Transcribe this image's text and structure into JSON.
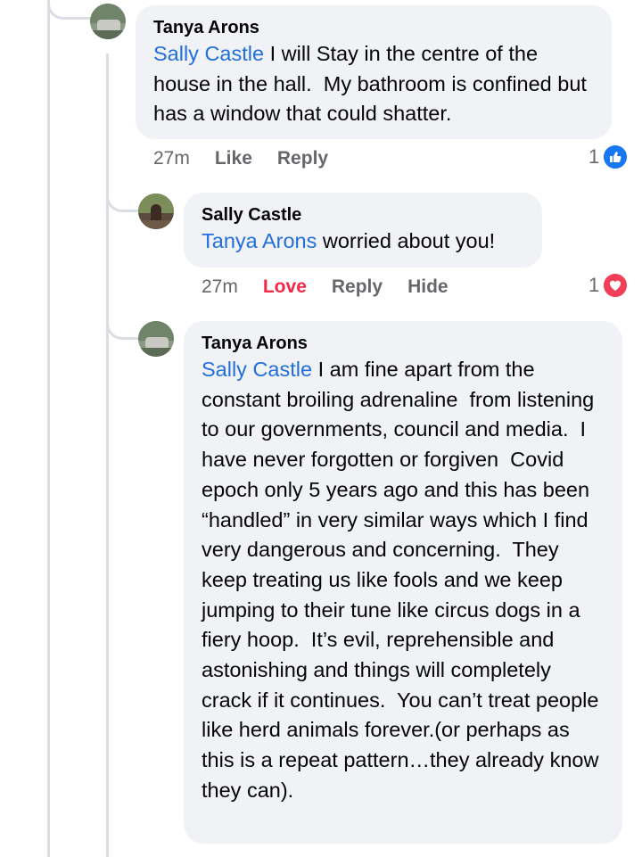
{
  "comments": [
    {
      "author": "Tanya Arons",
      "mention": "Sally Castle",
      "text": " I will Stay in the centre of the house in the hall.  My bathroom is confined but has a window that could shatter.",
      "time": "27m",
      "actions": [
        "Like",
        "Reply"
      ],
      "reaction_count": "1",
      "reaction_icon": "like-icon"
    },
    {
      "author": "Sally Castle",
      "mention": "Tanya Arons",
      "text": " worried about you!",
      "time": "27m",
      "actions": [
        "Love",
        "Reply",
        "Hide"
      ],
      "reaction_count": "1",
      "reaction_icon": "heart-icon"
    },
    {
      "author": "Tanya Arons",
      "mention": "Sally Castle",
      "text": " I am fine apart from the constant broiling adrenaline  from listening to our governments, council and media.  I have never forgotten or forgiven  Covid epoch only 5 years ago and this has been “handled” in very similar ways which I find very dangerous and concerning.  They keep treating us like fools and we keep jumping to their tune like circus dogs in a fiery hoop.  It’s evil, reprehensible and astonishing and things will completely crack if it continues.  You can’t treat people like herd animals forever.(or perhaps as this is a repeat pattern…they already know they can)."
    }
  ],
  "colors": {
    "mention": "#216fdb",
    "love": "#f02849",
    "like_badge": "#1877f2",
    "heart_badge": "#f33e58",
    "bubble": "#f0f2f5"
  }
}
